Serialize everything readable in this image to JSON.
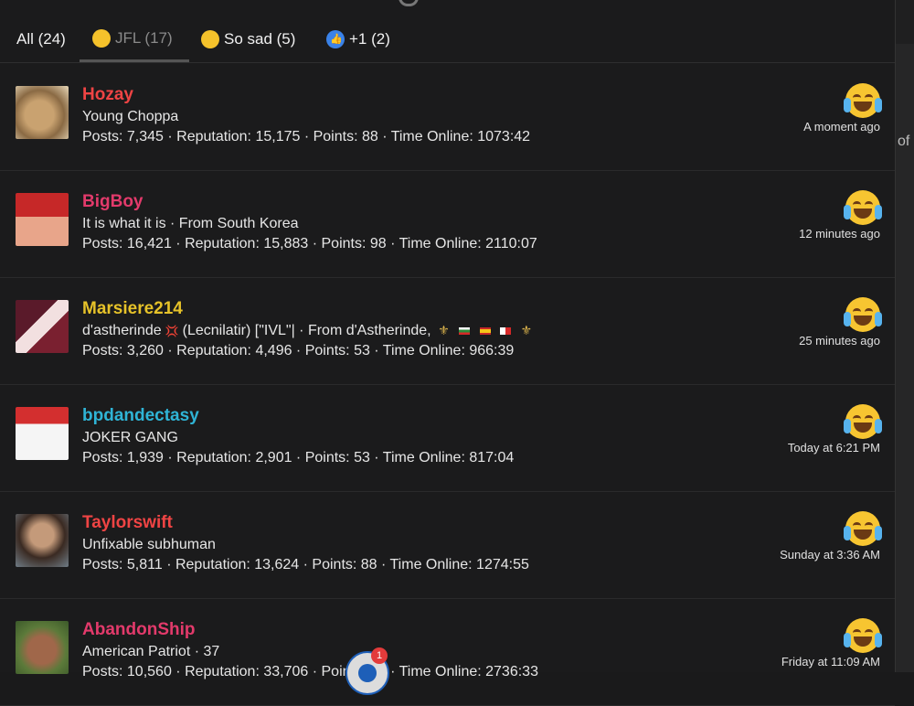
{
  "background": {
    "side_text": "of"
  },
  "tabs": [
    {
      "label": "All (24)",
      "icon": ""
    },
    {
      "label": "JFL (17)",
      "icon": "laugh-cry-emoji-icon"
    },
    {
      "label": "So sad (5)",
      "icon": "sad-emoji-icon"
    },
    {
      "label": "+1 (2)",
      "icon": "thumbs-up-icon"
    }
  ],
  "active_tab": 1,
  "users": [
    {
      "name": "Hozay",
      "name_color": "#ef4444",
      "subtitle": "Young Choppa",
      "stats": "Posts: 7,345 · Reputation: 15,175 · Points: 88 · Time Online: 1073:42",
      "time": "A moment ago",
      "avatar": "caracal-avatar"
    },
    {
      "name": "BigBoy",
      "name_color": "#e33a6b",
      "subtitle": "It is what it is · From South Korea",
      "stats": "Posts: 16,421 · Reputation: 15,883 · Points: 98 · Time Online: 2110:07",
      "time": "12 minutes ago",
      "avatar": "red-hat-avatar"
    },
    {
      "name": "Marsiere214",
      "name_color": "#e6c229",
      "subtitle_a": "d'astherinde",
      "subtitle_b": "(Lecnilatir) [\"IVL\"| · From d'Astherinde,",
      "stats": "Posts: 3,260 · Reputation: 4,496 · Points: 53 · Time Online: 966:39",
      "time": "25 minutes ago",
      "avatar": "anime-girl-avatar"
    },
    {
      "name": "bpdandectasy",
      "name_color": "#2fb4d6",
      "subtitle": "JOKER GANG",
      "stats": "Posts: 1,939 · Reputation: 2,901 · Points: 53 · Time Online: 817:04",
      "time": "Today at 6:21 PM",
      "avatar": "skull-hat-avatar"
    },
    {
      "name": "Taylorswift",
      "name_color": "#ef4444",
      "subtitle": "Unfixable subhuman",
      "stats": "Posts: 5,811 · Reputation: 13,624 · Points: 88 · Time Online: 1274:55",
      "time": "Sunday at 3:36 AM",
      "avatar": "man-photo-avatar"
    },
    {
      "name": "AbandonShip",
      "name_color": "#e33a6b",
      "subtitle": "American Patriot · 37",
      "stats": "Posts: 10,560 · Reputation: 33,706 · Points: 88 · Time Online: 2736:33",
      "time": "Friday at 11:09 AM",
      "avatar": "cartoon-man-avatar"
    }
  ],
  "chat_badge": "1",
  "colors": {
    "background": "#1b1b1c",
    "reaction_yellow": "#f7c531"
  }
}
